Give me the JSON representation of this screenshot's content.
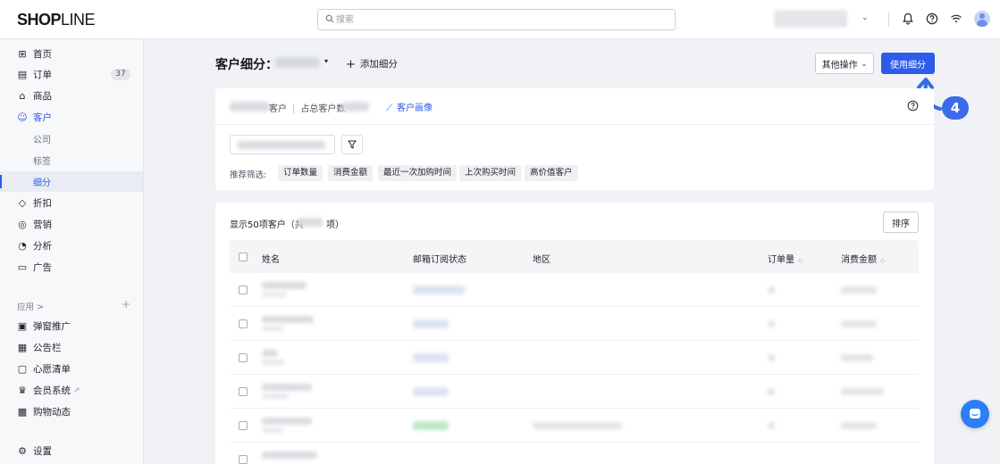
{
  "topbar": {
    "logo_bold": "SHOP",
    "logo_thin": "LINE",
    "search_placeholder": "搜索"
  },
  "sidebar": {
    "items": [
      {
        "label": "首页",
        "icon": "home-icon"
      },
      {
        "label": "订单",
        "icon": "order-icon",
        "badge": "37"
      },
      {
        "label": "商品",
        "icon": "product-icon"
      },
      {
        "label": "客户",
        "icon": "customer-icon"
      },
      {
        "label": "公司"
      },
      {
        "label": "标签"
      },
      {
        "label": "细分"
      },
      {
        "label": "折扣",
        "icon": "discount-icon"
      },
      {
        "label": "营销",
        "icon": "marketing-icon"
      },
      {
        "label": "分析",
        "icon": "analytics-icon"
      },
      {
        "label": "广告",
        "icon": "ads-icon"
      }
    ],
    "apps_label": "应用 >",
    "apps": [
      {
        "label": "弹窗推广",
        "icon": "popup-icon"
      },
      {
        "label": "公告栏",
        "icon": "announcement-icon"
      },
      {
        "label": "心愿清单",
        "icon": "wishlist-icon"
      },
      {
        "label": "会员系统",
        "icon": "membership-icon"
      },
      {
        "label": "购物动态",
        "icon": "shopping-feed-icon"
      }
    ],
    "settings_label": "设置"
  },
  "header": {
    "title": "客户细分：",
    "add_segment": "添加细分",
    "more_actions": "其他操作",
    "use_segment": "使用细分"
  },
  "summary_card": {
    "customers_label": "客户",
    "share_label": "占总客户数",
    "persona_link": "客户画像"
  },
  "filters": {
    "recommended_label": "推荐筛选:",
    "chips": [
      "订单数量",
      "消费金额",
      "最近一次加购时间",
      "上次购买时间",
      "高价值客户"
    ]
  },
  "list": {
    "showing_prefix": "显示50项客户（共",
    "showing_suffix": "项）",
    "sort_label": "排序",
    "columns": {
      "name": "姓名",
      "email_status": "邮箱订阅状态",
      "region": "地区",
      "orders": "订单量",
      "spent": "消费金额"
    }
  },
  "step_badge": "4",
  "colors": {
    "primary": "#2d5bea",
    "badge": "#3a6be8",
    "chat": "#2d7ff9"
  }
}
